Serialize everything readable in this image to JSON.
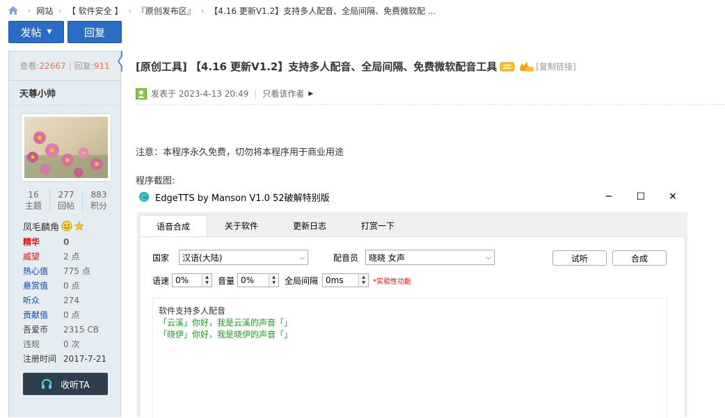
{
  "breadcrumb": {
    "items": [
      "网站",
      "【 软件安全 】",
      "『原创发布区』",
      "【4.16 更新V1.2】支持多人配音、全局间隔、免费微软配 ..."
    ]
  },
  "toolbar": {
    "post_label": "发帖",
    "reply_label": "回复"
  },
  "sidebar": {
    "views_label": "查看:",
    "views": "22667",
    "replies_label": "回复:",
    "replies": "911",
    "username": "天尊小帅",
    "counts": [
      {
        "value": "16",
        "label": "主题"
      },
      {
        "value": "277",
        "label": "回帖"
      },
      {
        "value": "883",
        "label": "积分"
      }
    ],
    "medal_label": "凤毛麟角",
    "info": [
      {
        "key": "精华",
        "value": "0",
        "style": "red"
      },
      {
        "key": "威望",
        "value": "2 点",
        "style": "red"
      },
      {
        "key": "热心值",
        "value": "775 点",
        "style": "blue"
      },
      {
        "key": "悬赏值",
        "value": "0 点",
        "style": "blue"
      },
      {
        "key": "听众",
        "value": "274",
        "style": "blue"
      },
      {
        "key": "贡献值",
        "value": "0 点",
        "style": "blue"
      },
      {
        "key": "吾爱币",
        "value": "2315 CB",
        "style": "normal"
      },
      {
        "key": "违规",
        "value": "0 次",
        "style": "normal"
      },
      {
        "key": "注册时间",
        "value": "2017-7-21",
        "style": "normal"
      }
    ],
    "listen_label": "收听TA"
  },
  "post": {
    "title": "[原创工具] 【4.16 更新V1.2】支持多人配音、全局间隔、免费微软配音工具",
    "copy_link": "[复制链接]",
    "posted_label": "发表于 2023-4-13 20:49",
    "author_only": "只看该作者",
    "notice": "注意：本程序永久免费，切勿将本程序用于商业用途",
    "screenshot_label": "程序截图:"
  },
  "app": {
    "title": "EdgeTTS by Manson V1.0 52破解特别版",
    "tabs": [
      "语音合成",
      "关于软件",
      "更新日志",
      "打赏一下"
    ],
    "country_label": "国家",
    "country_value": "汉语(大陆)",
    "voice_label": "配音员",
    "voice_value": "晓晓 女声",
    "preview_button": "试听",
    "synth_button": "合成",
    "speed_label": "语速",
    "speed_value": "0%",
    "volume_label": "音量",
    "volume_value": "0%",
    "interval_label": "全局间隔",
    "interval_value": "0ms",
    "experimental": "*实验性功能",
    "text_lines": [
      "软件支持多人配音",
      "「云溪」你好，我是云溪的声音「」",
      "「晓伊」你好，我是晓伊的声音「」"
    ]
  }
}
